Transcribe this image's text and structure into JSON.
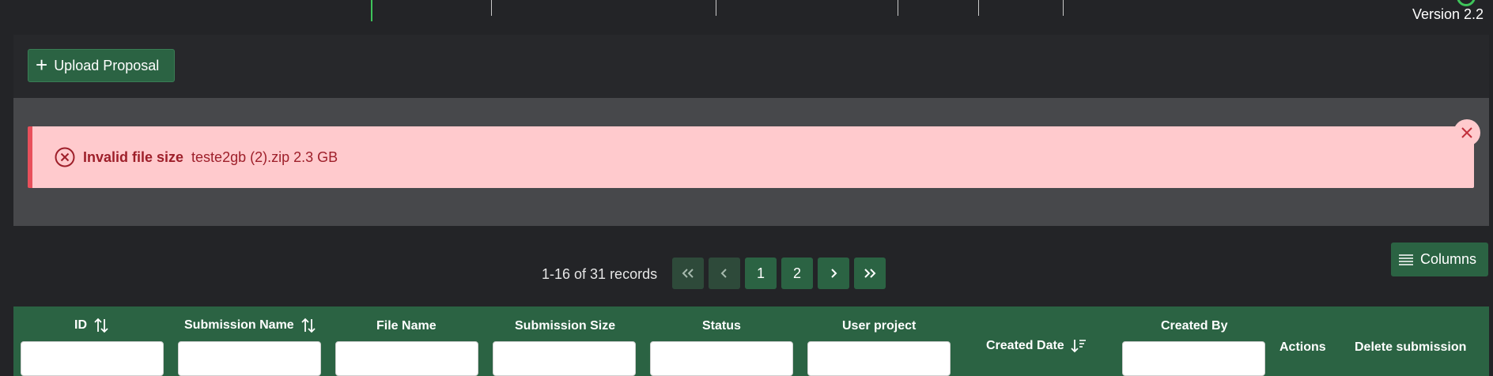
{
  "header": {
    "version": "Version 2.2"
  },
  "toolbar": {
    "upload_label": "Upload Proposal"
  },
  "alert": {
    "title": "Invalid file size",
    "detail": "teste2gb (2).zip 2.3 GB"
  },
  "pagination": {
    "records_text": "1-16 of 31 records",
    "first_icon": "double-chevron-left-icon",
    "prev_icon": "chevron-left-icon",
    "pages": [
      "1",
      "2"
    ],
    "next_icon": "chevron-right-icon",
    "last_icon": "double-chevron-right-icon"
  },
  "columns_button": {
    "label": "Columns"
  },
  "table": {
    "headers": {
      "id": "ID",
      "submission_name": "Submission Name",
      "file_name": "File Name",
      "submission_size": "Submission Size",
      "status": "Status",
      "user_project": "User project",
      "created_date": "Created Date",
      "created_by": "Created By",
      "actions": "Actions",
      "delete_submission": "Delete submission"
    }
  },
  "colors": {
    "accent_green": "#2b6343",
    "alert_bg": "#ffcacd",
    "alert_text": "#9e1f2a"
  }
}
